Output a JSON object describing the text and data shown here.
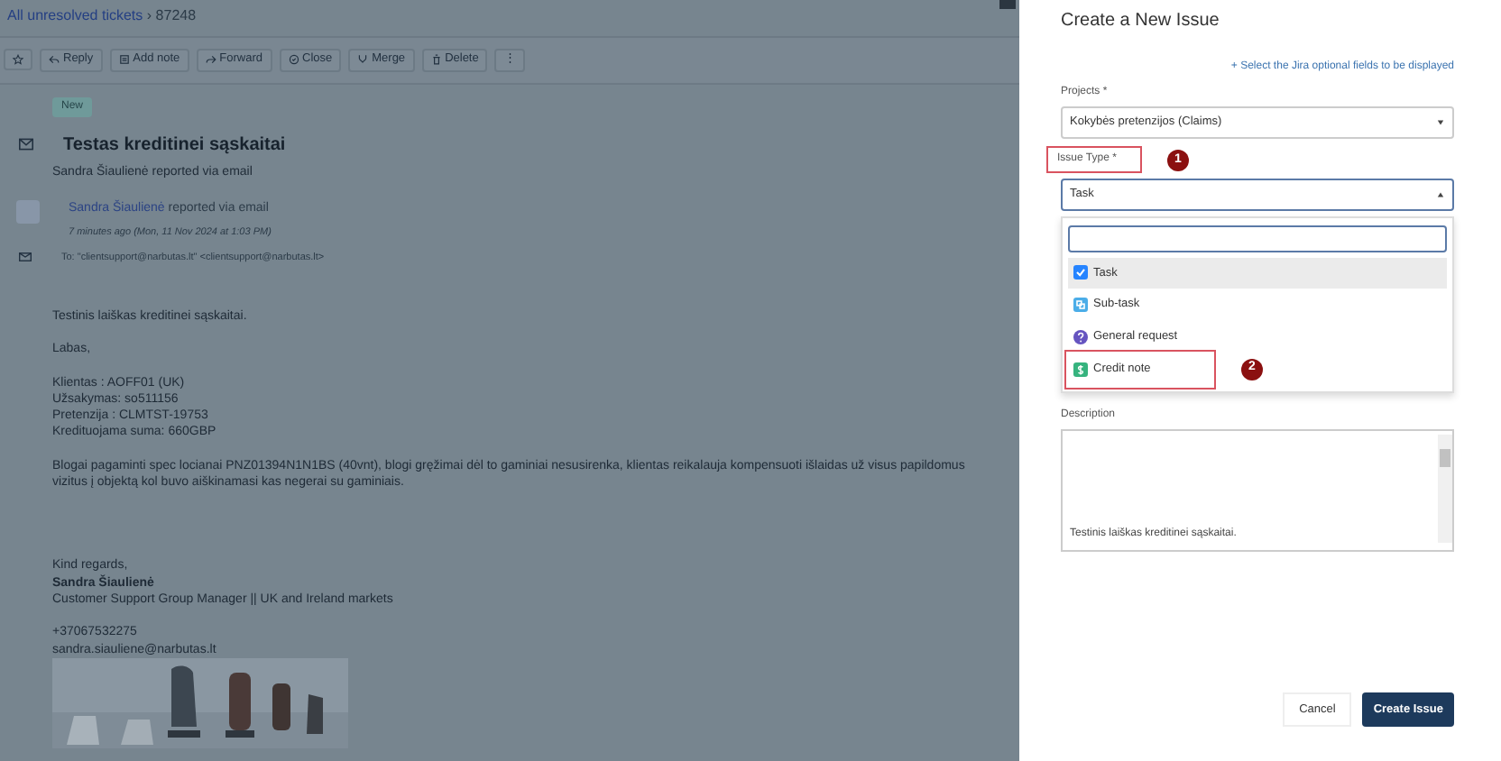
{
  "breadcrumb": {
    "link": "All unresolved tickets",
    "separator": "›",
    "current": "87248"
  },
  "toolbar": [
    "Reply",
    "Add note",
    "Forward",
    "Close",
    "Merge",
    "Delete",
    "⋮"
  ],
  "status_badge": "New",
  "ticket": {
    "title": "Testas kreditinei sąskaitai",
    "requester": "Sandra Šiaulienė",
    "requester_note": "reported via email"
  },
  "message": {
    "sender": "Sandra Šiaulienė",
    "via": "reported via email",
    "time": "7 minutes ago (Mon, 11 Nov 2024 at 1:03 PM)",
    "to": "To: \"clientsupport@narbutas.lt\" <clientsupport@narbutas.lt>",
    "paragraphs": [
      [
        "Testinis laiškas kreditinei sąskaitai."
      ],
      [
        "Labas,"
      ],
      [
        "Klientas : AOFF01 (UK)",
        "Užsakymas: so511156",
        "Pretenzija : CLMTST-19753",
        "Kredituojama suma: 660GBP"
      ],
      [
        "Blogai pagaminti spec locianai PNZ01394N1N1BS (40vnt), blogi gręžimai dėl to gaminiai nesusirenka, klientas reikalauja kompensuoti išlaidas už visus papildomus vizitus į objektą kol buvo aiškinamasi kas negerai su gaminiais."
      ]
    ],
    "signature": {
      "closing": "Kind regards,",
      "name": "Sandra Šiaulienė",
      "role": "Customer Support Group Manager || UK and Ireland markets",
      "phone": "+37067532275",
      "email": "sandra.siauliene@narbutas.lt"
    },
    "attachment": {
      "kind": "picture"
    }
  },
  "panel": {
    "title": "Create a New Issue",
    "optional_link": "+ Select the Jira optional fields to be displayed",
    "project": {
      "label": "Projects *",
      "value": "Kokybės pretenzijos (Claims)"
    },
    "issue_type": {
      "label": "Issue Type *",
      "annotation": "1",
      "value": "Task",
      "expanded": true,
      "options": [
        {
          "label": "Task",
          "kind": "task",
          "color": "#2684ff",
          "selected": true
        },
        {
          "label": "Sub-task",
          "kind": "subtask",
          "color": "#4bade8",
          "selected": false
        },
        {
          "label": "General request",
          "kind": "request",
          "color": "#6554c0",
          "selected": false
        },
        {
          "label": "Credit note",
          "kind": "credit",
          "color": "#36b37e",
          "selected": false,
          "annotation": "2"
        }
      ]
    },
    "description": {
      "label": "Description",
      "value": "Testinis laiškas kreditinei sąskaitai."
    },
    "buttons": [
      {
        "label": "Cancel",
        "kind": "secondary"
      },
      {
        "label": "Create Issue",
        "kind": "primary"
      }
    ]
  }
}
